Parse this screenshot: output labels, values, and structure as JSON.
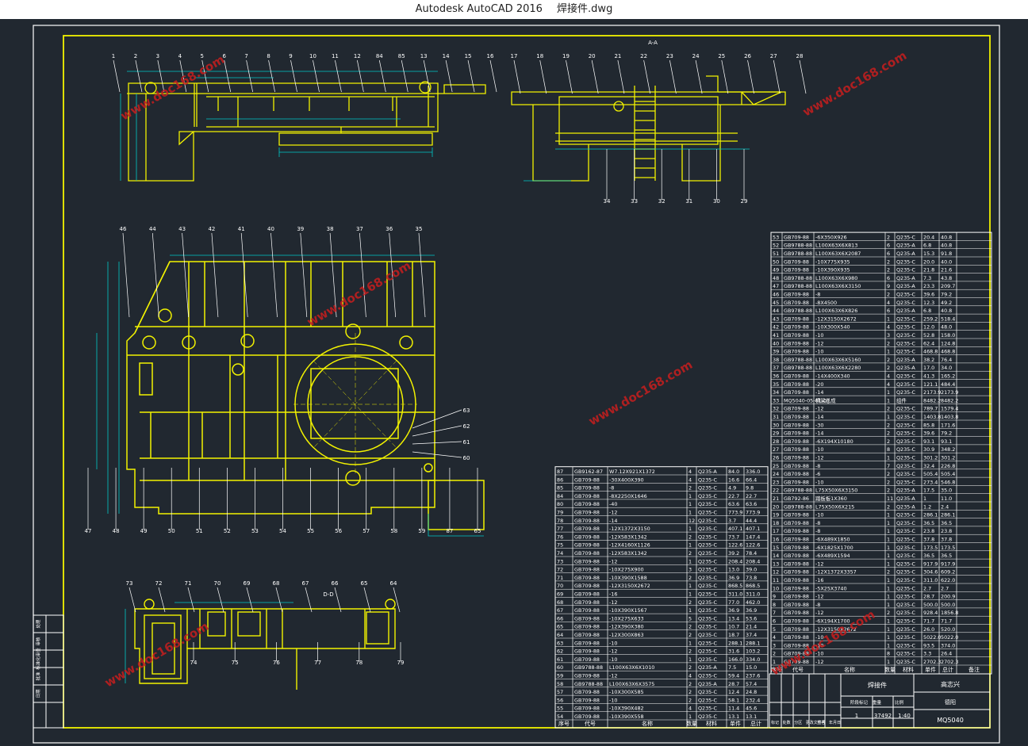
{
  "window": {
    "app_title": "Autodesk AutoCAD 2016",
    "file_name": "焊接件.dwg"
  },
  "colors": {
    "background": "#212830",
    "frame": "#ffffff",
    "geometry": "#f2f200",
    "table": "#00c8c8",
    "dimension": "#00c8c8",
    "label": "#ffffff",
    "watermark": "#c81e1e"
  },
  "view_labels": {
    "section_aa": "A-A",
    "section_dd": "D-D"
  },
  "watermark_text": "www.doc168.com",
  "top_view_balloons": [
    "1",
    "2",
    "3",
    "4",
    "5",
    "6",
    "7",
    "8",
    "9",
    "10",
    "11",
    "12",
    "84",
    "85",
    "13",
    "14",
    "15",
    "16"
  ],
  "side_view_balloons": [
    "17",
    "18",
    "19",
    "20",
    "21",
    "22",
    "23",
    "24",
    "25",
    "26",
    "27",
    "28"
  ],
  "side_view_bottom_balloons": [
    "34",
    "33",
    "32",
    "31",
    "30",
    "29"
  ],
  "plan_view_balloons_top": [
    "46",
    "44",
    "43",
    "42",
    "41",
    "40",
    "39",
    "38",
    "37",
    "36",
    "35"
  ],
  "plan_view_balloons_bottom": [
    "47",
    "48",
    "49",
    "50",
    "51",
    "52",
    "53",
    "54",
    "55",
    "56",
    "57",
    "58",
    "59",
    "87",
    "65"
  ],
  "plan_view_balloons_right": [
    "63",
    "62",
    "61",
    "60"
  ],
  "dd_view_balloons": [
    "73",
    "72",
    "71",
    "70",
    "69",
    "68",
    "67",
    "66",
    "65",
    "64"
  ],
  "dd_view_balloons_bottom": [
    "74",
    "75",
    "76",
    "77",
    "78",
    "79"
  ],
  "side_block_labels": [
    "处理",
    "审核",
    "标准化审查",
    "批准",
    "日期"
  ],
  "bom_left": {
    "rows": [
      [
        "87",
        "GB9162-87",
        "W7.12X921X1372",
        "4",
        "Q235-A",
        "84.0",
        "336.0"
      ],
      [
        "86",
        "GB709-88",
        "-30X400X390",
        "4",
        "Q235-C",
        "16.6",
        "66.4"
      ],
      [
        "85",
        "GB709-88",
        "-8",
        "2",
        "Q235-C",
        "4.9",
        "9.8"
      ],
      [
        "84",
        "GB709-88",
        "-8X2250X1646",
        "1",
        "Q235-C",
        "22.7",
        "22.7"
      ],
      [
        "80",
        "GB709-88",
        "-40",
        "1",
        "Q235-C",
        "63.6",
        "63.6"
      ],
      [
        "79",
        "GB709-88",
        "-12",
        "1",
        "Q235-C",
        "773.9",
        "773.9"
      ],
      [
        "78",
        "GB709-88",
        "-14",
        "12",
        "Q235-C",
        "3.7",
        "44.4"
      ],
      [
        "77",
        "GB709-88",
        "-12X1372X3150",
        "1",
        "Q235-C",
        "407.1",
        "407.1"
      ],
      [
        "76",
        "GB709-88",
        "-12X583X1342",
        "2",
        "Q235-C",
        "73.7",
        "147.4"
      ],
      [
        "75",
        "GB709-88",
        "-12X4160X1126",
        "1",
        "Q235-C",
        "122.6",
        "122.6"
      ],
      [
        "74",
        "GB709-88",
        "-12X583X1342",
        "2",
        "Q235-C",
        "39.2",
        "78.4"
      ],
      [
        "73",
        "GB709-88",
        "-12",
        "1",
        "Q235-C",
        "208.4",
        "208.4"
      ],
      [
        "72",
        "GB709-88",
        "-10X275X900",
        "3",
        "Q235-C",
        "13.0",
        "39.0"
      ],
      [
        "71",
        "GB709-88",
        "-10X390X1588",
        "2",
        "Q235-C",
        "36.9",
        "73.8"
      ],
      [
        "70",
        "GB709-88",
        "-12X3150X2672",
        "1",
        "Q235-C",
        "868.5",
        "868.5"
      ],
      [
        "69",
        "GB709-88",
        "-16",
        "1",
        "Q235-C",
        "311.0",
        "311.0"
      ],
      [
        "68",
        "GB709-88",
        "-12",
        "2",
        "Q235-C",
        "77.0",
        "462.0"
      ],
      [
        "67",
        "GB709-88",
        "-10X390X1567",
        "1",
        "Q235-C",
        "36.9",
        "36.9"
      ],
      [
        "66",
        "GB709-88",
        "-10X275X633",
        "5",
        "Q235-C",
        "13.4",
        "53.6"
      ],
      [
        "65",
        "GB709-88",
        "-12X390X380",
        "2",
        "Q235-C",
        "10.7",
        "21.4"
      ],
      [
        "64",
        "GB709-88",
        "-12X300X863",
        "2",
        "Q235-C",
        "18.7",
        "37.4"
      ],
      [
        "63",
        "GB709-88",
        "-10",
        "1",
        "Q235-C",
        "288.1",
        "288.1"
      ],
      [
        "62",
        "GB709-88",
        "-12",
        "2",
        "Q235-C",
        "31.6",
        "103.2"
      ],
      [
        "61",
        "GB709-88",
        "-10",
        "1",
        "Q235-C",
        "166.0",
        "334.0"
      ],
      [
        "60",
        "GB9788-88",
        "L100X63X6X1010",
        "2",
        "Q235-A",
        "7.5",
        "15.0"
      ],
      [
        "59",
        "GB709-88",
        "-12",
        "4",
        "Q235-C",
        "59.4",
        "237.6"
      ],
      [
        "58",
        "GB9788-88",
        "L100X63X6X3575",
        "2",
        "Q235-A",
        "28.7",
        "57.4"
      ],
      [
        "57",
        "GB709-88",
        "-10X300X585",
        "2",
        "Q235-C",
        "12.4",
        "24.8"
      ],
      [
        "56",
        "GB709-88",
        "-10",
        "2",
        "Q235-C",
        "58.1",
        "232.4"
      ],
      [
        "55",
        "GB709-88",
        "-10X390X482",
        "4",
        "Q235-C",
        "11.4",
        "45.6"
      ],
      [
        "54",
        "GB709-88",
        "-10X390X558",
        "1",
        "Q235-C",
        "13.1",
        "13.1"
      ]
    ],
    "header": [
      "序号",
      "代号",
      "名称",
      "数量",
      "材料",
      "单件",
      "总计"
    ]
  },
  "bom_right": {
    "rows": [
      [
        "53",
        "GB709-88",
        "-6X350X926",
        "2",
        "Q235-C",
        "20.4",
        "40.8"
      ],
      [
        "52",
        "GB9788-88",
        "L100X63X6X813",
        "6",
        "Q235-A",
        "6.8",
        "40.8"
      ],
      [
        "51",
        "GB9788-88",
        "L100X63X6X2087",
        "6",
        "Q235-A",
        "15.3",
        "91.8"
      ],
      [
        "50",
        "GB709-88",
        "-10X775X935",
        "2",
        "Q235-C",
        "20.0",
        "40.0"
      ],
      [
        "49",
        "GB709-88",
        "-10X390X935",
        "2",
        "Q235-C",
        "21.8",
        "21.6"
      ],
      [
        "48",
        "GB9788-88",
        "L100X63X6X980",
        "6",
        "Q235-A",
        "7.3",
        "43.8"
      ],
      [
        "47",
        "GB9788-88",
        "L100X63X6X3150",
        "9",
        "Q235-A",
        "23.3",
        "209.7"
      ],
      [
        "46",
        "GB709-88",
        "-8",
        "2",
        "Q235-C",
        "39.6",
        "79.2"
      ],
      [
        "45",
        "GB709-88",
        "-8X4500",
        "4",
        "Q235-C",
        "12.3",
        "49.2"
      ],
      [
        "44",
        "GB9788-88",
        "L100X63X6X826",
        "6",
        "Q235-A",
        "6.8",
        "40.8"
      ],
      [
        "43",
        "GB709-88",
        "-12X3150X2672",
        "1",
        "Q235-C",
        "259.2",
        "518.4"
      ],
      [
        "42",
        "GB709-88",
        "-10X300X540",
        "4",
        "Q235-C",
        "12.0",
        "48.0"
      ],
      [
        "41",
        "GB709-88",
        "-10",
        "3",
        "Q235-C",
        "52.8",
        "158.0"
      ],
      [
        "40",
        "GB709-88",
        "-12",
        "2",
        "Q235-C",
        "62.4",
        "124.8"
      ],
      [
        "39",
        "GB709-88",
        "-10",
        "1",
        "Q235-C",
        "468.8",
        "468.8"
      ],
      [
        "38",
        "GB9788-88",
        "L100X63X6X5160",
        "2",
        "Q235-A",
        "38.2",
        "76.4"
      ],
      [
        "37",
        "GB9788-88",
        "L100X63X6X2280",
        "2",
        "Q235-A",
        "17.0",
        "34.0"
      ],
      [
        "36",
        "GB709-88",
        "-14X400X340",
        "4",
        "Q235-C",
        "41.3",
        "165.2"
      ],
      [
        "35",
        "GB709-88",
        "-20",
        "4",
        "Q235-C",
        "121.1",
        "484.4"
      ],
      [
        "34",
        "GB709-88",
        "-14",
        "1",
        "Q235-C",
        "2173.9",
        "2173.9"
      ],
      [
        "33",
        "MQ5040-05-01-01",
        "横梁总成",
        "1",
        "组件",
        "8482.2",
        "8482.2"
      ],
      [
        "32",
        "GB709-88",
        "-12",
        "2",
        "Q235-C",
        "789.7",
        "1579.4"
      ],
      [
        "31",
        "GB709-88",
        "-14",
        "1",
        "Q235-C",
        "1403.8",
        "1403.8"
      ],
      [
        "30",
        "GB709-88",
        "-30",
        "2",
        "Q235-C",
        "85.8",
        "171.6"
      ],
      [
        "29",
        "GB709-88",
        "-14",
        "2",
        "Q235-C",
        "39.6",
        "79.2"
      ],
      [
        "28",
        "GB709-88",
        "-6X194X10180",
        "2",
        "Q235-C",
        "93.1",
        "93.1"
      ],
      [
        "27",
        "GB709-88",
        "-10",
        "8",
        "Q235-C",
        "30.9",
        "348.2"
      ],
      [
        "26",
        "GB709-88",
        "-12",
        "1",
        "Q235-C",
        "301.2",
        "301.2"
      ],
      [
        "25",
        "GB709-88",
        "-8",
        "7",
        "Q235-C",
        "32.4",
        "226.8"
      ],
      [
        "24",
        "GB709-88",
        "-6",
        "2",
        "Q235-C",
        "505.4",
        "505.4"
      ],
      [
        "23",
        "GB709-88",
        "-10",
        "2",
        "Q235-C",
        "273.4",
        "546.8"
      ],
      [
        "22",
        "GB9788-88",
        "L75X50X6X3150",
        "2",
        "Q235-A",
        "17.5",
        "35.0"
      ],
      [
        "21",
        "GB792-86",
        "踏板板1X360",
        "11",
        "Q235-A",
        "1",
        "11.0"
      ],
      [
        "20",
        "GB9788-88",
        "L75X50X6X215",
        "2",
        "Q235-A",
        "1.2",
        "2.4"
      ],
      [
        "19",
        "GB709-88",
        "-10",
        "1",
        "Q235-C",
        "286.1",
        "286.1"
      ],
      [
        "18",
        "GB709-88",
        "-8",
        "1",
        "Q235-C",
        "36.5",
        "36.5"
      ],
      [
        "17",
        "GB709-88",
        "-8",
        "1",
        "Q235-C",
        "23.8",
        "23.8"
      ],
      [
        "16",
        "GB709-88",
        "-6X489X1850",
        "1",
        "Q235-C",
        "37.8",
        "37.8"
      ],
      [
        "15",
        "GB709-88",
        "-6X1825X1700",
        "1",
        "Q235-C",
        "173.5",
        "173.5"
      ],
      [
        "14",
        "GB709-88",
        "-6X489X1594",
        "1",
        "Q235-C",
        "36.5",
        "36.5"
      ],
      [
        "13",
        "GB709-88",
        "-12",
        "1",
        "Q235-C",
        "917.9",
        "917.9"
      ],
      [
        "12",
        "GB709-88",
        "-12X1372X3357",
        "2",
        "Q235-C",
        "304.6",
        "609.2"
      ],
      [
        "11",
        "GB709-88",
        "-16",
        "1",
        "Q235-C",
        "311.0",
        "622.0"
      ],
      [
        "10",
        "GB709-88",
        "-5X25X3740",
        "1",
        "Q235-C",
        "2.7",
        "2.7"
      ],
      [
        "9",
        "GB709-88",
        "-12",
        "1",
        "Q235-C",
        "28.7",
        "200.9"
      ],
      [
        "8",
        "GB709-88",
        "-8",
        "1",
        "Q235-C",
        "500.0",
        "500.0"
      ],
      [
        "7",
        "GB709-88",
        "-12",
        "2",
        "Q235-C",
        "928.4",
        "1856.8"
      ],
      [
        "6",
        "GB709-88",
        "-6X194X1700",
        "1",
        "Q235-C",
        "71.7",
        "71.7"
      ],
      [
        "5",
        "GB709-88",
        "-12X3150X2672",
        "1",
        "Q235-C",
        "26.0",
        "520.0"
      ],
      [
        "4",
        "GB709-88",
        "-10",
        "1",
        "Q235-C",
        "5022.0",
        "5022.0"
      ],
      [
        "3",
        "GB709-88",
        "-10",
        "1",
        "Q235-C",
        "93.5",
        "374.0"
      ],
      [
        "2",
        "GB709-88",
        "-10",
        "8",
        "Q235-C",
        "3.3",
        "26.4"
      ],
      [
        "1",
        "GB709-88",
        "-12",
        "1",
        "Q235-C",
        "2702.3",
        "2702.3"
      ]
    ],
    "header": [
      "序号",
      "代号",
      "名称",
      "数量",
      "材料",
      "单件",
      "总计",
      "备注"
    ]
  },
  "title_block": {
    "part_name": "焊接件",
    "designer": "高志兴",
    "school": "德阳",
    "drawing_no": "MQ5040",
    "weight": "37492",
    "scale": "1:40",
    "sheet": "1",
    "row_labels": [
      "标记",
      "处数",
      "分区",
      "更改文件号",
      "签名",
      "年月日"
    ],
    "col_labels": [
      "阶段标记",
      "重量",
      "比例"
    ]
  }
}
